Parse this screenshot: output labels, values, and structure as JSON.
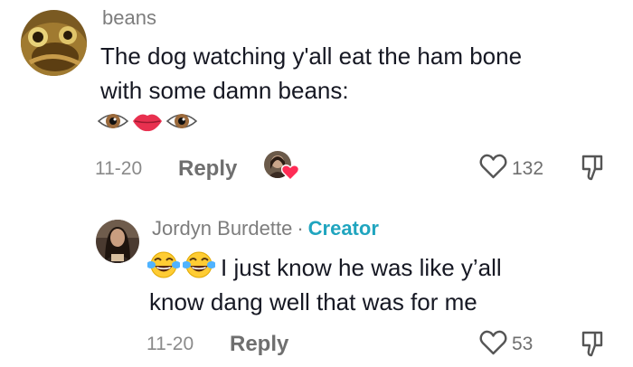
{
  "comment": {
    "username": "beans",
    "text_line1": "The dog watching y'all eat the ham bone",
    "text_line2": "with some damn beans:",
    "emojis": [
      "eye",
      "lips",
      "eye"
    ],
    "date": "11-20",
    "reply_label": "Reply",
    "like_count": "132"
  },
  "reply": {
    "username": "Jordyn Burdette",
    "separator": "·",
    "creator_badge": "Creator",
    "creator_color": "#20a5bf",
    "emoji_prefix": [
      "face-with-tears-of-joy",
      "face-with-tears-of-joy"
    ],
    "text_line1": "I just know he was like y’all",
    "text_line2": "know dang well that was for me",
    "date": "11-20",
    "reply_label": "Reply",
    "like_count": "53"
  },
  "colors": {
    "liked_by_creator_heart": "#fe2c55"
  }
}
